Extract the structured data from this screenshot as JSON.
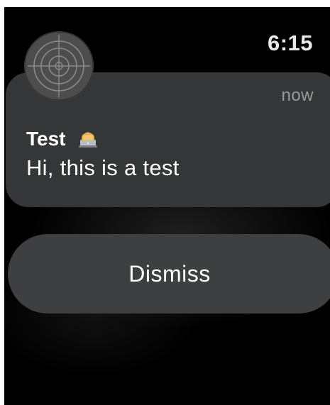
{
  "status_bar": {
    "time": "6:15"
  },
  "notification": {
    "timestamp": "now",
    "title": "Test",
    "title_emoji": "technologist-emoji",
    "message": "Hi, this is a test",
    "app_icon": "target-icon",
    "background_color": "#353637"
  },
  "actions": {
    "dismiss_label": "Dismiss"
  },
  "colors": {
    "screen_background": "#000000",
    "button_background": "#3e3f40",
    "secondary_text": "#9a9a9a"
  }
}
